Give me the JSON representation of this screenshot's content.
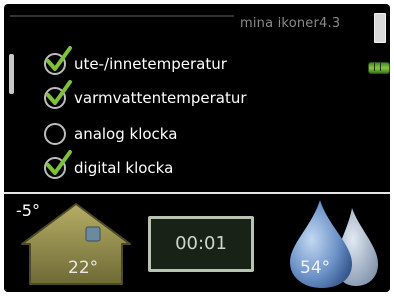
{
  "header": {
    "title": "mina ikoner4.3"
  },
  "options": [
    {
      "label": "ute-/innetemperatur",
      "checked": true
    },
    {
      "label": "varmvattentemperatur",
      "checked": true
    },
    {
      "label": "analog klocka",
      "checked": false
    },
    {
      "label": "digital klocka",
      "checked": true
    }
  ],
  "status": {
    "outdoor_temp": "-5°",
    "indoor_temp": "22°",
    "clock": "00:01",
    "hot_water_temp": "54°"
  },
  "colors": {
    "accent_green": "#7dc13a",
    "screen_bg": "#000000"
  }
}
